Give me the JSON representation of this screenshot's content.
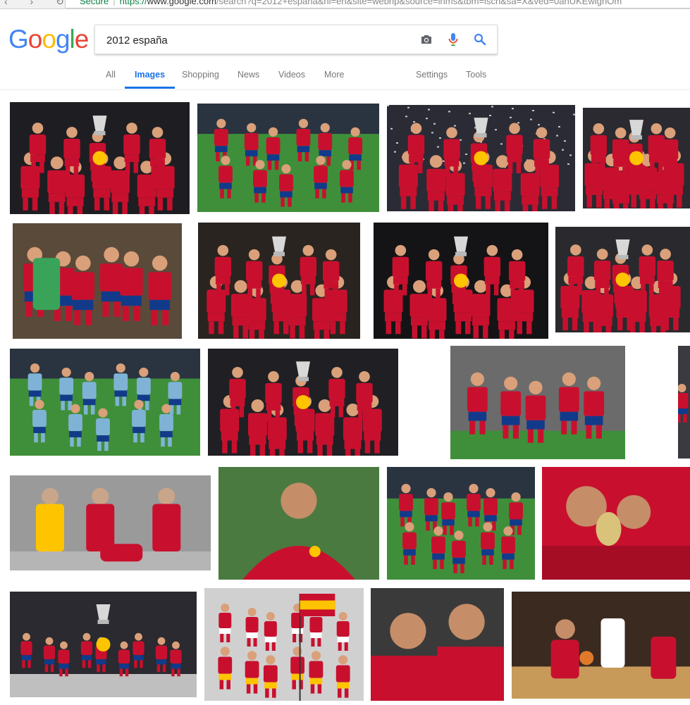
{
  "browser": {
    "secure_label": "Secure",
    "url_scheme": "https://",
    "url_host": "www.google.com",
    "url_path": "/search?q=2012+españa&hl=en&site=webhp&source=lnms&tbm=isch&sa=X&ved=0ahUKEwighOm"
  },
  "logo": {
    "letters": [
      "G",
      "o",
      "o",
      "g",
      "l",
      "e"
    ],
    "colors": [
      "#4285f4",
      "#ea4335",
      "#fbbc05",
      "#4285f4",
      "#34a853",
      "#ea4335"
    ]
  },
  "search": {
    "query": "2012 españa",
    "icons": [
      "camera-icon",
      "microphone-icon",
      "search-icon"
    ]
  },
  "tabs": {
    "all": "All",
    "images": "Images",
    "shopping": "Shopping",
    "news": "News",
    "videos": "Videos",
    "more": "More",
    "settings": "Settings",
    "tools": "Tools"
  },
  "colors": {
    "accent": "#1a73e8",
    "spain_red": "#c8102e",
    "spain_yellow": "#ffc400",
    "away_blue": "#7fb3d5",
    "pitch_green": "#3f8f3a",
    "dark_bg": "#1e1e22"
  },
  "results": [
    {
      "scene": "trophy-celebration",
      "bg": "#1e1e22"
    },
    {
      "scene": "team-photo",
      "bg": "#3f8f3a"
    },
    {
      "scene": "confetti-celebration",
      "bg": "#2b2b35"
    },
    {
      "scene": "trophy-celebration",
      "bg": "#2a2a30"
    },
    {
      "scene": "team-huddle",
      "bg": "#5a4a3a"
    },
    {
      "scene": "trophy-celebration",
      "bg": "#2a2420"
    },
    {
      "scene": "trophy-celebration",
      "bg": "#141416"
    },
    {
      "scene": "trophy-celebration",
      "bg": "#2a2a2e"
    },
    {
      "scene": "team-photo-blue",
      "bg": "#3f8f3a"
    },
    {
      "scene": "trophy-celebration",
      "bg": "#202024"
    },
    {
      "scene": "players-on-pitch",
      "bg": "#6b6b6b"
    },
    {
      "scene": "partial",
      "bg": "#3a3a40"
    },
    {
      "scene": "kit-presentation",
      "bg": "#9a9a9a"
    },
    {
      "scene": "player-portrait",
      "bg": "#4a7a40"
    },
    {
      "scene": "team-photo",
      "bg": "#3f8f3a"
    },
    {
      "scene": "trophy-kiss",
      "bg": "#c8102e"
    },
    {
      "scene": "stadium-celebration",
      "bg": "#2a2a30"
    },
    {
      "scene": "olympic-parade",
      "bg": "#d0d0d0"
    },
    {
      "scene": "two-players",
      "bg": "#3a3a3a"
    },
    {
      "scene": "basketball",
      "bg": "#3a2a20"
    }
  ]
}
